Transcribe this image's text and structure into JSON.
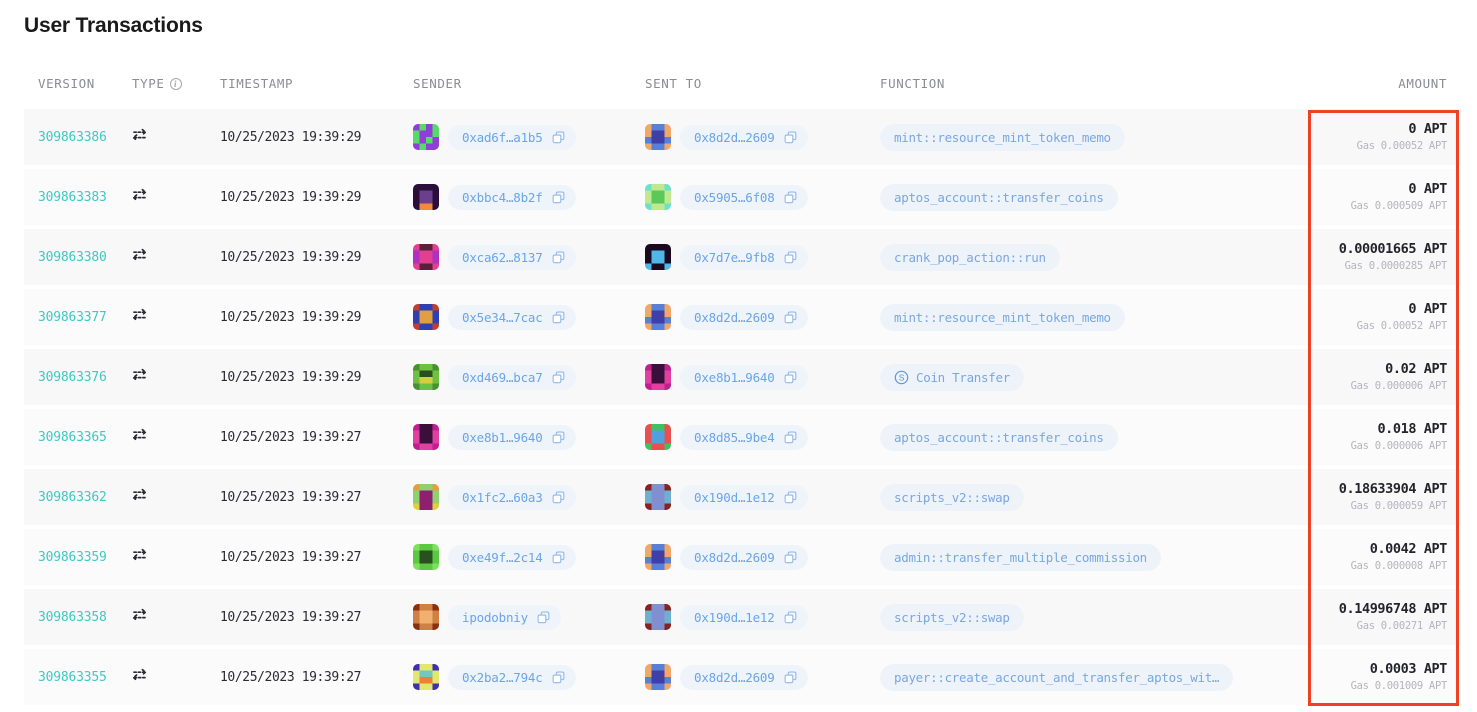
{
  "page": {
    "title": "User Transactions"
  },
  "annotation": {
    "name": "amount-column-highlight",
    "color": "#ef4123"
  },
  "table": {
    "columns": [
      {
        "key": "version",
        "label": "VERSION"
      },
      {
        "key": "type",
        "label": "TYPE",
        "icon": "info-icon"
      },
      {
        "key": "timestamp",
        "label": "TIMESTAMP"
      },
      {
        "key": "sender",
        "label": "SENDER"
      },
      {
        "key": "sent_to",
        "label": "SENT TO"
      },
      {
        "key": "function",
        "label": "FUNCTION"
      },
      {
        "key": "amount",
        "label": "AMOUNT"
      }
    ],
    "rows": [
      {
        "version": "309863386",
        "type_icon": "transaction-exchange-icon",
        "timestamp": "10/25/2023 19:39:29",
        "sender": "0xad6f…a1b5",
        "sender_avatar": [
          "#8f3fd6",
          "#59d96a",
          "#8f3fd6",
          "#59d96a",
          "#59d96a",
          "#8f3fd6",
          "#8f3fd6",
          "#59d96a",
          "#59d96a",
          "#8f3fd6",
          "#59d96a",
          "#8f3fd6",
          "#8f3fd6",
          "#59d96a",
          "#8f3fd6",
          "#8f3fd6"
        ],
        "sent_to": "0x8d2d…2609",
        "sent_to_avatar": [
          "#f0a868",
          "#5a7fd6",
          "#5a7fd6",
          "#f0a868",
          "#f0a868",
          "#3f3fa8",
          "#3f3fa8",
          "#f0a868",
          "#5a7fd6",
          "#3f3fa8",
          "#3f3fa8",
          "#5a7fd6",
          "#f0a868",
          "#5a7fd6",
          "#5a7fd6",
          "#f0a868"
        ],
        "function": "mint::resource_mint_token_memo",
        "function_icon": null,
        "amount": "0 APT",
        "gas": "Gas 0.00052 APT"
      },
      {
        "version": "309863383",
        "type_icon": "transaction-exchange-icon",
        "timestamp": "10/25/2023 19:39:29",
        "sender": "0xbbc4…8b2f",
        "sender_avatar": [
          "#2b0f3a",
          "#2b0f3a",
          "#2b0f3a",
          "#2b0f3a",
          "#2b0f3a",
          "#6b3f8c",
          "#6b3f8c",
          "#2b0f3a",
          "#2b0f3a",
          "#6b3f8c",
          "#6b3f8c",
          "#2b0f3a",
          "#2b0f3a",
          "#f08a3c",
          "#f08a3c",
          "#2b0f3a"
        ],
        "sent_to": "0x5905…6f08",
        "sent_to_avatar": [
          "#6fe0c8",
          "#bfe890",
          "#bfe890",
          "#6fe0c8",
          "#bfe890",
          "#5ac85a",
          "#5ac85a",
          "#bfe890",
          "#bfe890",
          "#5ac85a",
          "#5ac85a",
          "#bfe890",
          "#6fe0c8",
          "#bfe890",
          "#bfe890",
          "#6fe0c8"
        ],
        "function": "aptos_account::transfer_coins",
        "function_icon": null,
        "amount": "0 APT",
        "gas": "Gas 0.000509 APT"
      },
      {
        "version": "309863380",
        "type_icon": "transaction-exchange-icon",
        "timestamp": "10/25/2023 19:39:29",
        "sender": "0xca62…8137",
        "sender_avatar": [
          "#e0408f",
          "#5a1f3a",
          "#5a1f3a",
          "#e0408f",
          "#b030c0",
          "#e0408f",
          "#e0408f",
          "#b030c0",
          "#b030c0",
          "#e0408f",
          "#e0408f",
          "#b030c0",
          "#e0408f",
          "#5a1f3a",
          "#5a1f3a",
          "#e0408f"
        ],
        "sent_to": "0x7d7e…9fb8",
        "sent_to_avatar": [
          "#1a0a1f",
          "#1a0a1f",
          "#1a0a1f",
          "#1a0a1f",
          "#1a0a1f",
          "#4fb8e8",
          "#4fb8e8",
          "#1a0a1f",
          "#1a0a1f",
          "#4fb8e8",
          "#4fb8e8",
          "#1a0a1f",
          "#4fb8e8",
          "#1a0a1f",
          "#1a0a1f",
          "#4fb8e8"
        ],
        "function": "crank_pop_action::run",
        "function_icon": null,
        "amount": "0.00001665 APT",
        "gas": "Gas 0.0000285 APT"
      },
      {
        "version": "309863377",
        "type_icon": "transaction-exchange-icon",
        "timestamp": "10/25/2023 19:39:29",
        "sender": "0x5e34…7cac",
        "sender_avatar": [
          "#c04030",
          "#3040b0",
          "#3040b0",
          "#c04030",
          "#3040b0",
          "#e0a040",
          "#e0a040",
          "#3040b0",
          "#3040b0",
          "#e0a040",
          "#e0a040",
          "#3040b0",
          "#c04030",
          "#3040b0",
          "#3040b0",
          "#c04030"
        ],
        "sent_to": "0x8d2d…2609",
        "sent_to_avatar": [
          "#f0a868",
          "#5a7fd6",
          "#5a7fd6",
          "#f0a868",
          "#f0a868",
          "#3f3fa8",
          "#3f3fa8",
          "#f0a868",
          "#5a7fd6",
          "#3f3fa8",
          "#3f3fa8",
          "#5a7fd6",
          "#f0a868",
          "#5a7fd6",
          "#5a7fd6",
          "#f0a868"
        ],
        "function": "mint::resource_mint_token_memo",
        "function_icon": null,
        "amount": "0 APT",
        "gas": "Gas 0.00052 APT"
      },
      {
        "version": "309863376",
        "type_icon": "transaction-exchange-icon",
        "timestamp": "10/25/2023 19:39:29",
        "sender": "0xd469…bca7",
        "sender_avatar": [
          "#4a9030",
          "#6fc040",
          "#6fc040",
          "#4a9030",
          "#6fc040",
          "#2a5020",
          "#2a5020",
          "#6fc040",
          "#6fc040",
          "#d0d040",
          "#d0d040",
          "#6fc040",
          "#4a9030",
          "#6fc040",
          "#6fc040",
          "#4a9030"
        ],
        "sent_to": "0xe8b1…9640",
        "sent_to_avatar": [
          "#c0208f",
          "#3a0f3a",
          "#3a0f3a",
          "#c0208f",
          "#e040a0",
          "#3a0f3a",
          "#3a0f3a",
          "#e040a0",
          "#e040a0",
          "#3a0f3a",
          "#3a0f3a",
          "#e040a0",
          "#c0208f",
          "#e040a0",
          "#e040a0",
          "#c0208f"
        ],
        "function": "Coin Transfer",
        "function_icon": "coin-transfer-icon",
        "amount": "0.02 APT",
        "gas": "Gas 0.000006 APT"
      },
      {
        "version": "309863365",
        "type_icon": "transaction-exchange-icon",
        "timestamp": "10/25/2023 19:39:27",
        "sender": "0xe8b1…9640",
        "sender_avatar": [
          "#c0208f",
          "#3a0f3a",
          "#3a0f3a",
          "#c0208f",
          "#e040a0",
          "#3a0f3a",
          "#3a0f3a",
          "#e040a0",
          "#e040a0",
          "#3a0f3a",
          "#3a0f3a",
          "#e040a0",
          "#c0208f",
          "#e040a0",
          "#e040a0",
          "#c0208f"
        ],
        "sent_to": "0x8d85…9be4",
        "sent_to_avatar": [
          "#e85050",
          "#40c060",
          "#40c060",
          "#e85050",
          "#e85050",
          "#50a0e0",
          "#50a0e0",
          "#e85050",
          "#e85050",
          "#50a0e0",
          "#50a0e0",
          "#e85050",
          "#40c060",
          "#e85050",
          "#e85050",
          "#40c060"
        ],
        "function": "aptos_account::transfer_coins",
        "function_icon": null,
        "amount": "0.018 APT",
        "gas": "Gas 0.000006 APT"
      },
      {
        "version": "309863362",
        "type_icon": "transaction-exchange-icon",
        "timestamp": "10/25/2023 19:39:27",
        "sender": "0x1fc2…60a3",
        "sender_avatar": [
          "#e0a040",
          "#8fd070",
          "#8fd070",
          "#e0a040",
          "#8fd070",
          "#8f2070",
          "#8f2070",
          "#8fd070",
          "#8fd070",
          "#8f2070",
          "#8f2070",
          "#8fd070",
          "#e0d040",
          "#8f2070",
          "#8f2070",
          "#e0d040"
        ],
        "sent_to": "0x190d…1e12",
        "sent_to_avatar": [
          "#8a2020",
          "#7f8fd0",
          "#7f8fd0",
          "#8a2020",
          "#6fb0d0",
          "#7f8fd0",
          "#7f8fd0",
          "#6fb0d0",
          "#6fb0d0",
          "#7f8fd0",
          "#7f8fd0",
          "#6fb0d0",
          "#8a2020",
          "#7f8fd0",
          "#7f8fd0",
          "#8a2020"
        ],
        "function": "scripts_v2::swap",
        "function_icon": null,
        "amount": "0.18633904 APT",
        "gas": "Gas 0.000059 APT"
      },
      {
        "version": "309863359",
        "type_icon": "transaction-exchange-icon",
        "timestamp": "10/25/2023 19:39:27",
        "sender": "0xe49f…2c14",
        "sender_avatar": [
          "#7fe060",
          "#5ac840",
          "#5ac840",
          "#7fe060",
          "#5ac840",
          "#2a5020",
          "#2a5020",
          "#5ac840",
          "#5ac840",
          "#2a5020",
          "#2a5020",
          "#5ac840",
          "#7fe060",
          "#5ac840",
          "#5ac840",
          "#7fe060"
        ],
        "sent_to": "0x8d2d…2609",
        "sent_to_avatar": [
          "#f0a868",
          "#5a7fd6",
          "#5a7fd6",
          "#f0a868",
          "#f0a868",
          "#3f3fa8",
          "#3f3fa8",
          "#f0a868",
          "#5a7fd6",
          "#3f3fa8",
          "#3f3fa8",
          "#5a7fd6",
          "#f0a868",
          "#5a7fd6",
          "#5a7fd6",
          "#f0a868"
        ],
        "function": "admin::transfer_multiple_commission",
        "function_icon": null,
        "amount": "0.0042 APT",
        "gas": "Gas 0.000008 APT"
      },
      {
        "version": "309863358",
        "type_icon": "transaction-exchange-icon",
        "timestamp": "10/25/2023 19:39:27",
        "sender": "ipodobniy",
        "sender_avatar": [
          "#8a3010",
          "#d08040",
          "#d08040",
          "#8a3010",
          "#d08040",
          "#f0b070",
          "#f0b070",
          "#d08040",
          "#d08040",
          "#f0b070",
          "#f0b070",
          "#d08040",
          "#8a3010",
          "#d08040",
          "#d08040",
          "#8a3010"
        ],
        "sent_to": "0x190d…1e12",
        "sent_to_avatar": [
          "#8a2020",
          "#7f8fd0",
          "#7f8fd0",
          "#8a2020",
          "#6fb0d0",
          "#7f8fd0",
          "#7f8fd0",
          "#6fb0d0",
          "#6fb0d0",
          "#7f8fd0",
          "#7f8fd0",
          "#6fb0d0",
          "#8a2020",
          "#7f8fd0",
          "#7f8fd0",
          "#8a2020"
        ],
        "function": "scripts_v2::swap",
        "function_icon": null,
        "amount": "0.14996748 APT",
        "gas": "Gas 0.00271 APT"
      },
      {
        "version": "309863355",
        "type_icon": "transaction-exchange-icon",
        "timestamp": "10/25/2023 19:39:27",
        "sender": "0x2ba2…794c",
        "sender_avatar": [
          "#4030b0",
          "#e0e870",
          "#e0e870",
          "#4030b0",
          "#e0e870",
          "#70c8c0",
          "#70c8c0",
          "#e0e870",
          "#e0e870",
          "#f08030",
          "#f08030",
          "#e0e870",
          "#4030b0",
          "#e0e870",
          "#e0e870",
          "#4030b0"
        ],
        "sent_to": "0x8d2d…2609",
        "sent_to_avatar": [
          "#f0a868",
          "#5a7fd6",
          "#5a7fd6",
          "#f0a868",
          "#f0a868",
          "#3f3fa8",
          "#3f3fa8",
          "#f0a868",
          "#5a7fd6",
          "#3f3fa8",
          "#3f3fa8",
          "#5a7fd6",
          "#f0a868",
          "#5a7fd6",
          "#5a7fd6",
          "#f0a868"
        ],
        "function": "payer::create_account_and_transfer_aptos_wit…",
        "function_icon": null,
        "amount": "0.0003 APT",
        "gas": "Gas 0.001009 APT"
      }
    ]
  }
}
